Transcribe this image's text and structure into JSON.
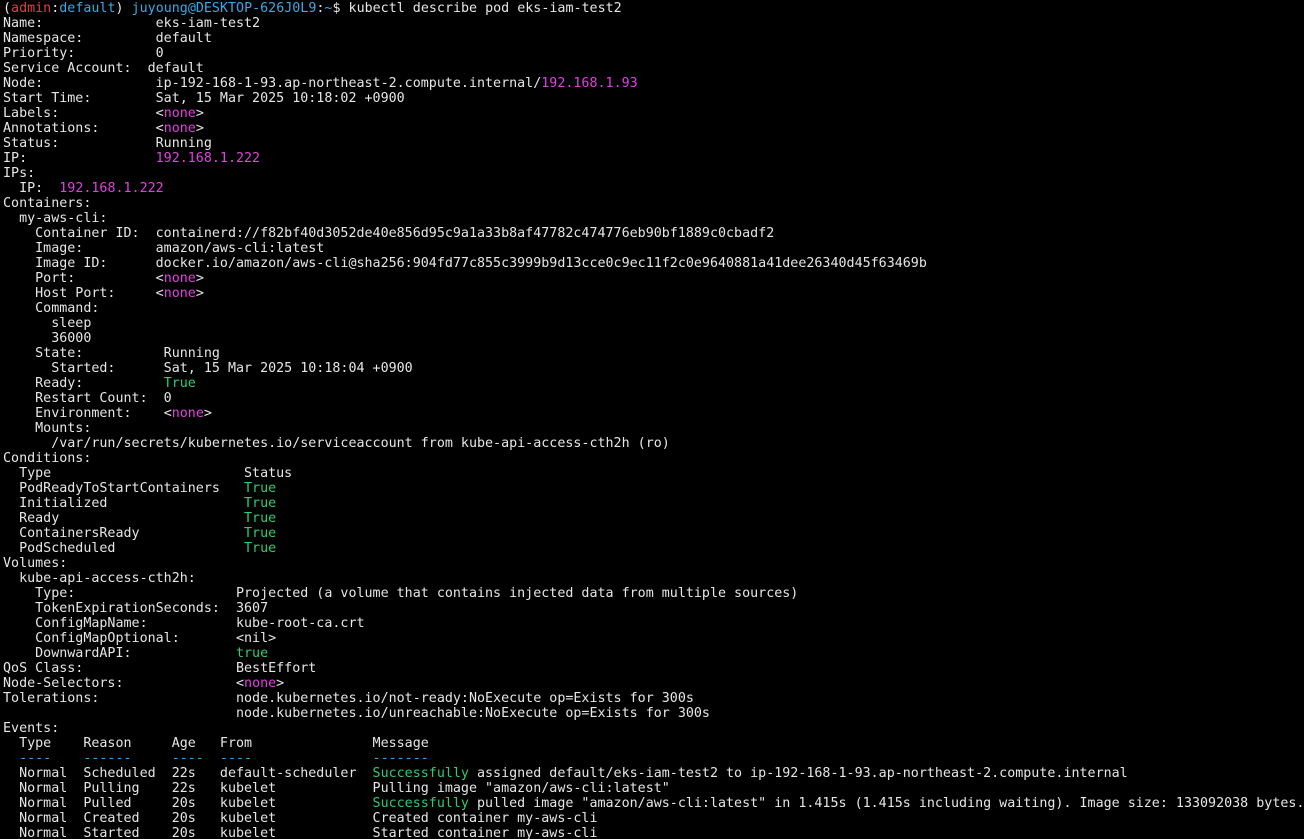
{
  "colors": {
    "background": "#000000",
    "text": "#e6e6e6",
    "value_highlight": "#e040e0",
    "status_true": "#2ecc71",
    "prompt_user": "#3aa8e6",
    "prompt_ctx": "#e04040"
  },
  "lines": [
    [
      {
        "t": "(",
        "c": "white"
      },
      {
        "t": "admin",
        "c": "red"
      },
      {
        "t": ":",
        "c": "white"
      },
      {
        "t": "default",
        "c": "cyan"
      },
      {
        "t": ") ",
        "c": "white"
      },
      {
        "t": "juyoung@DESKTOP-626J0L9",
        "c": "cyan"
      },
      {
        "t": ":",
        "c": "white"
      },
      {
        "t": "~",
        "c": "cyan"
      },
      {
        "t": "$ kubectl describe pod eks-iam-test2",
        "c": "white"
      }
    ],
    [
      {
        "t": "Name:              eks-iam-test2",
        "c": "white"
      }
    ],
    [
      {
        "t": "Namespace:         default",
        "c": "white"
      }
    ],
    [
      {
        "t": "Priority:          0",
        "c": "white"
      }
    ],
    [
      {
        "t": "Service Account:  default",
        "c": "white"
      }
    ],
    [
      {
        "t": "Node:              ip-192-168-1-93.ap-northeast-2.compute.internal/",
        "c": "white"
      },
      {
        "t": "192.168.1.93",
        "c": "pink"
      }
    ],
    [
      {
        "t": "Start Time:        Sat, 15 Mar 2025 10:18:02 +0900",
        "c": "white"
      }
    ],
    [
      {
        "t": "Labels:            ",
        "c": "white"
      },
      {
        "t": "<",
        "c": "white"
      },
      {
        "t": "none",
        "c": "pink"
      },
      {
        "t": ">",
        "c": "white"
      }
    ],
    [
      {
        "t": "Annotations:       ",
        "c": "white"
      },
      {
        "t": "<",
        "c": "white"
      },
      {
        "t": "none",
        "c": "pink"
      },
      {
        "t": ">",
        "c": "white"
      }
    ],
    [
      {
        "t": "Status:            Running",
        "c": "white"
      }
    ],
    [
      {
        "t": "IP:                ",
        "c": "white"
      },
      {
        "t": "192.168.1.222",
        "c": "pink"
      }
    ],
    [
      {
        "t": "IPs:",
        "c": "white"
      }
    ],
    [
      {
        "t": "  IP:  ",
        "c": "white"
      },
      {
        "t": "192.168.1.222",
        "c": "pink"
      }
    ],
    [
      {
        "t": "Containers:",
        "c": "white"
      }
    ],
    [
      {
        "t": "  my-aws-cli:",
        "c": "white"
      }
    ],
    [
      {
        "t": "    Container ID:  containerd://f82bf40d3052de40e856d95c9a1a33b8af47782c474776eb90bf1889c0cbadf2",
        "c": "white"
      }
    ],
    [
      {
        "t": "    Image:         amazon/aws-cli:latest",
        "c": "white"
      }
    ],
    [
      {
        "t": "    Image ID:      docker.io/amazon/aws-cli@sha256:904fd77c855c3999b9d13cce0c9ec11f2c0e9640881a41dee26340d45f63469b",
        "c": "white"
      }
    ],
    [
      {
        "t": "    Port:          ",
        "c": "white"
      },
      {
        "t": "<",
        "c": "white"
      },
      {
        "t": "none",
        "c": "pink"
      },
      {
        "t": ">",
        "c": "white"
      }
    ],
    [
      {
        "t": "    Host Port:     ",
        "c": "white"
      },
      {
        "t": "<",
        "c": "white"
      },
      {
        "t": "none",
        "c": "pink"
      },
      {
        "t": ">",
        "c": "white"
      }
    ],
    [
      {
        "t": "    Command:",
        "c": "white"
      }
    ],
    [
      {
        "t": "      sleep",
        "c": "white"
      }
    ],
    [
      {
        "t": "      36000",
        "c": "white"
      }
    ],
    [
      {
        "t": "    State:          Running",
        "c": "white"
      }
    ],
    [
      {
        "t": "      Started:      Sat, 15 Mar 2025 10:18:04 +0900",
        "c": "white"
      }
    ],
    [
      {
        "t": "    Ready:          ",
        "c": "white"
      },
      {
        "t": "True",
        "c": "green"
      }
    ],
    [
      {
        "t": "    Restart Count:  0",
        "c": "white"
      }
    ],
    [
      {
        "t": "    Environment:    ",
        "c": "white"
      },
      {
        "t": "<",
        "c": "white"
      },
      {
        "t": "none",
        "c": "pink"
      },
      {
        "t": ">",
        "c": "white"
      }
    ],
    [
      {
        "t": "    Mounts:",
        "c": "white"
      }
    ],
    [
      {
        "t": "      /var/run/secrets/kubernetes.io/serviceaccount from kube-api-access-cth2h (ro)",
        "c": "white"
      }
    ],
    [
      {
        "t": "Conditions:",
        "c": "white"
      }
    ],
    [
      {
        "t": "  Type                        Status",
        "c": "white"
      }
    ],
    [
      {
        "t": "  PodReadyToStartContainers   ",
        "c": "white"
      },
      {
        "t": "True",
        "c": "green"
      }
    ],
    [
      {
        "t": "  Initialized                 ",
        "c": "white"
      },
      {
        "t": "True",
        "c": "green"
      }
    ],
    [
      {
        "t": "  Ready                       ",
        "c": "white"
      },
      {
        "t": "True",
        "c": "green"
      }
    ],
    [
      {
        "t": "  ContainersReady             ",
        "c": "white"
      },
      {
        "t": "True",
        "c": "green"
      }
    ],
    [
      {
        "t": "  PodScheduled                ",
        "c": "white"
      },
      {
        "t": "True",
        "c": "green"
      }
    ],
    [
      {
        "t": "Volumes:",
        "c": "white"
      }
    ],
    [
      {
        "t": "  kube-api-access-cth2h:",
        "c": "white"
      }
    ],
    [
      {
        "t": "    Type:                    Projected (a volume that contains injected data from multiple sources)",
        "c": "white"
      }
    ],
    [
      {
        "t": "    TokenExpirationSeconds:  3607",
        "c": "white"
      }
    ],
    [
      {
        "t": "    ConfigMapName:           kube-root-ca.crt",
        "c": "white"
      }
    ],
    [
      {
        "t": "    ConfigMapOptional:       <nil>",
        "c": "white"
      }
    ],
    [
      {
        "t": "    DownwardAPI:             ",
        "c": "white"
      },
      {
        "t": "true",
        "c": "green"
      }
    ],
    [
      {
        "t": "QoS Class:                   BestEffort",
        "c": "white"
      }
    ],
    [
      {
        "t": "Node-Selectors:              ",
        "c": "white"
      },
      {
        "t": "<",
        "c": "white"
      },
      {
        "t": "none",
        "c": "pink"
      },
      {
        "t": ">",
        "c": "white"
      }
    ],
    [
      {
        "t": "Tolerations:                 node.kubernetes.io/not-ready:NoExecute op=Exists for 300s",
        "c": "white"
      }
    ],
    [
      {
        "t": "                             node.kubernetes.io/unreachable:NoExecute op=Exists for 300s",
        "c": "white"
      }
    ],
    [
      {
        "t": "Events:",
        "c": "white"
      }
    ],
    [
      {
        "t": "  Type    Reason     Age   From               Message",
        "c": "white"
      }
    ],
    [
      {
        "t": "  ----    ------     ----  ----               -------",
        "c": "cyan"
      }
    ],
    [
      {
        "t": "  Normal  Scheduled  22s   default-scheduler  ",
        "c": "white"
      },
      {
        "t": "Successfully",
        "c": "green"
      },
      {
        "t": " assigned default/eks-iam-test2 to ip-192-168-1-93.ap-northeast-2.compute.internal",
        "c": "white"
      }
    ],
    [
      {
        "t": "  Normal  Pulling    22s   kubelet            Pulling image \"amazon/aws-cli:latest\"",
        "c": "white"
      }
    ],
    [
      {
        "t": "  Normal  Pulled     20s   kubelet            ",
        "c": "white"
      },
      {
        "t": "Successfully",
        "c": "green"
      },
      {
        "t": " pulled image \"amazon/aws-cli:latest\" in 1.415s (1.415s including waiting). Image size: 133092038 bytes.",
        "c": "white"
      }
    ],
    [
      {
        "t": "  Normal  Created    20s   kubelet            Created container my-aws-cli",
        "c": "white"
      }
    ],
    [
      {
        "t": "  Normal  Started    20s   kubelet            Started container my-aws-cli",
        "c": "white"
      }
    ]
  ]
}
